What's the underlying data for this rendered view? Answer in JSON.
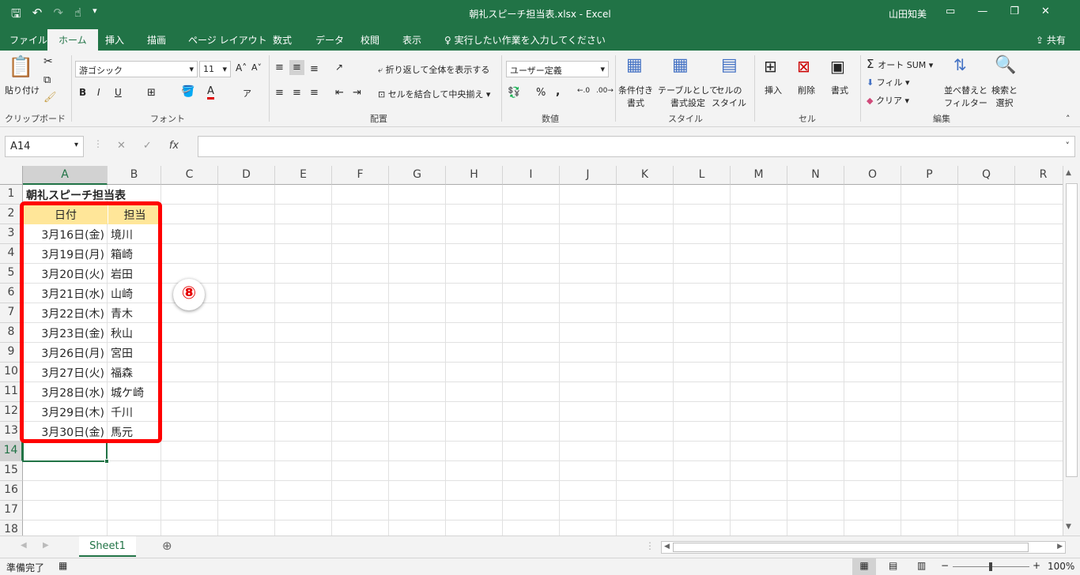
{
  "app": {
    "title": "朝礼スピーチ担当表.xlsx - Excel",
    "user": "山田知美"
  },
  "tabs": [
    "ファイル",
    "ホーム",
    "挿入",
    "描画",
    "ページ レイアウト",
    "数式",
    "データ",
    "校閲",
    "表示"
  ],
  "tell_me": "実行したい作業を入力してください",
  "share": "共有",
  "ribbon": {
    "clipboard": {
      "paste": "貼り付け",
      "label": "クリップボード"
    },
    "font": {
      "name": "游ゴシック",
      "size": "11",
      "label": "フォント"
    },
    "alignment": {
      "wrap": "折り返して全体を表示する",
      "merge": "セルを結合して中央揃え",
      "label": "配置"
    },
    "number": {
      "format": "ユーザー定義",
      "label": "数値"
    },
    "styles": {
      "cond1": "条件付き",
      "cond2": "書式",
      "table1": "テーブルとして",
      "table2": "書式設定",
      "cell1": "セルの",
      "cell2": "スタイル",
      "label": "スタイル"
    },
    "cells": {
      "insert": "挿入",
      "delete": "削除",
      "format": "書式",
      "label": "セル"
    },
    "editing": {
      "autosum": "オート SUM",
      "fill": "フィル",
      "clear": "クリア",
      "sort1": "並べ替えと",
      "sort2": "フィルター",
      "find1": "検索と",
      "find2": "選択",
      "label": "編集"
    }
  },
  "namebox": "A14",
  "columns": [
    "A",
    "B",
    "C",
    "D",
    "E",
    "F",
    "G",
    "H",
    "I",
    "J",
    "K",
    "L",
    "M",
    "N",
    "O",
    "P",
    "Q",
    "R"
  ],
  "rows": [
    "1",
    "2",
    "3",
    "4",
    "5",
    "6",
    "7",
    "8",
    "9",
    "10",
    "11",
    "12",
    "13",
    "14",
    "15",
    "16",
    "17",
    "18"
  ],
  "sheet": {
    "title": "朝礼スピーチ担当表",
    "headers": [
      "日付",
      "担当"
    ],
    "data": [
      [
        "3月16日(金)",
        "境川"
      ],
      [
        "3月19日(月)",
        "箱崎"
      ],
      [
        "3月20日(火)",
        "岩田"
      ],
      [
        "3月21日(水)",
        "山崎"
      ],
      [
        "3月22日(木)",
        "青木"
      ],
      [
        "3月23日(金)",
        "秋山"
      ],
      [
        "3月26日(月)",
        "宮田"
      ],
      [
        "3月27日(火)",
        "福森"
      ],
      [
        "3月28日(水)",
        "城ケ崎"
      ],
      [
        "3月29日(木)",
        "千川"
      ],
      [
        "3月30日(金)",
        "馬元"
      ]
    ]
  },
  "annotation": "⑧",
  "sheet_tab": "Sheet1",
  "status": {
    "ready": "準備完了",
    "zoom": "100%"
  },
  "colors": {
    "excel_green": "#217346",
    "header_fill": "#ffe699",
    "highlight": "#ff0000"
  }
}
